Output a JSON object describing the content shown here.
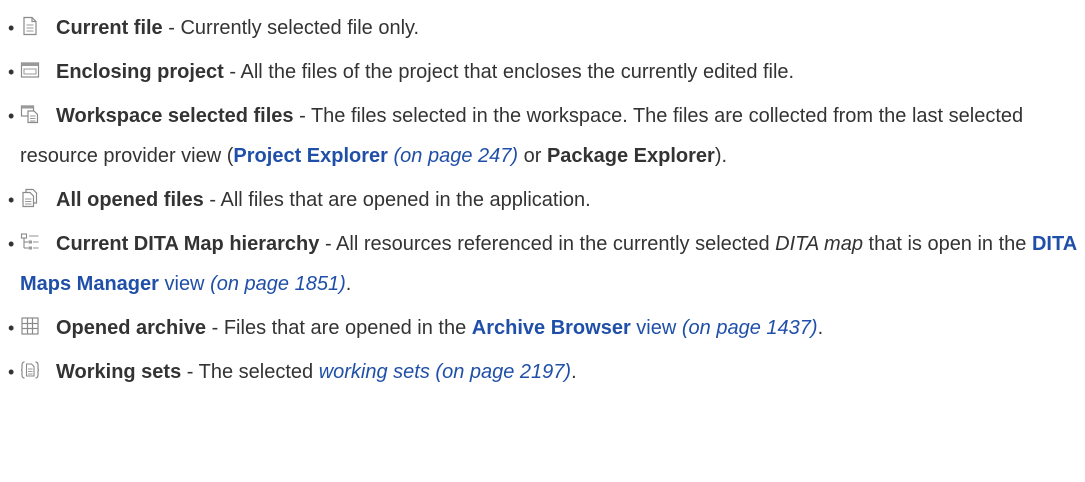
{
  "items": [
    {
      "icon": "current-file-icon",
      "term": "Current file",
      "desc": " - Currently selected file only."
    },
    {
      "icon": "enclosing-project-icon",
      "term": "Enclosing project",
      "desc": " - All the files of the project that encloses the currently edited file."
    },
    {
      "icon": "workspace-files-icon",
      "term": "Workspace selected files",
      "desc": " - The files selected in the workspace. The files are collected from the last selected resource provider view (",
      "link": "Project Explorer",
      "pageref": "(on page 247)",
      "mid": " or ",
      "ui": "Package Explorer",
      "tail": ")."
    },
    {
      "icon": "opened-files-icon",
      "term": "All opened files",
      "desc": " - All files that are opened in the application."
    },
    {
      "icon": "dita-hierarchy-icon",
      "term": "Current DITA Map hierarchy",
      "desc": " - All resources referenced in the currently selected ",
      "em": "DITA map",
      "desc2": " that is open in the ",
      "link": "DITA Maps Manager",
      "view": " view",
      "pageref": "(on page 1851)",
      "tail": "."
    },
    {
      "icon": "opened-archive-icon",
      "term": "Opened archive",
      "desc": " - Files that are opened in the ",
      "link": "Archive Browser",
      "view": " view",
      "pageref": "(on page 1437)",
      "tail": "."
    },
    {
      "icon": "working-sets-icon",
      "term": "Working sets",
      "desc": " - The selected ",
      "link": "working sets",
      "pageref": "(on page 2197)",
      "tail": "."
    }
  ]
}
